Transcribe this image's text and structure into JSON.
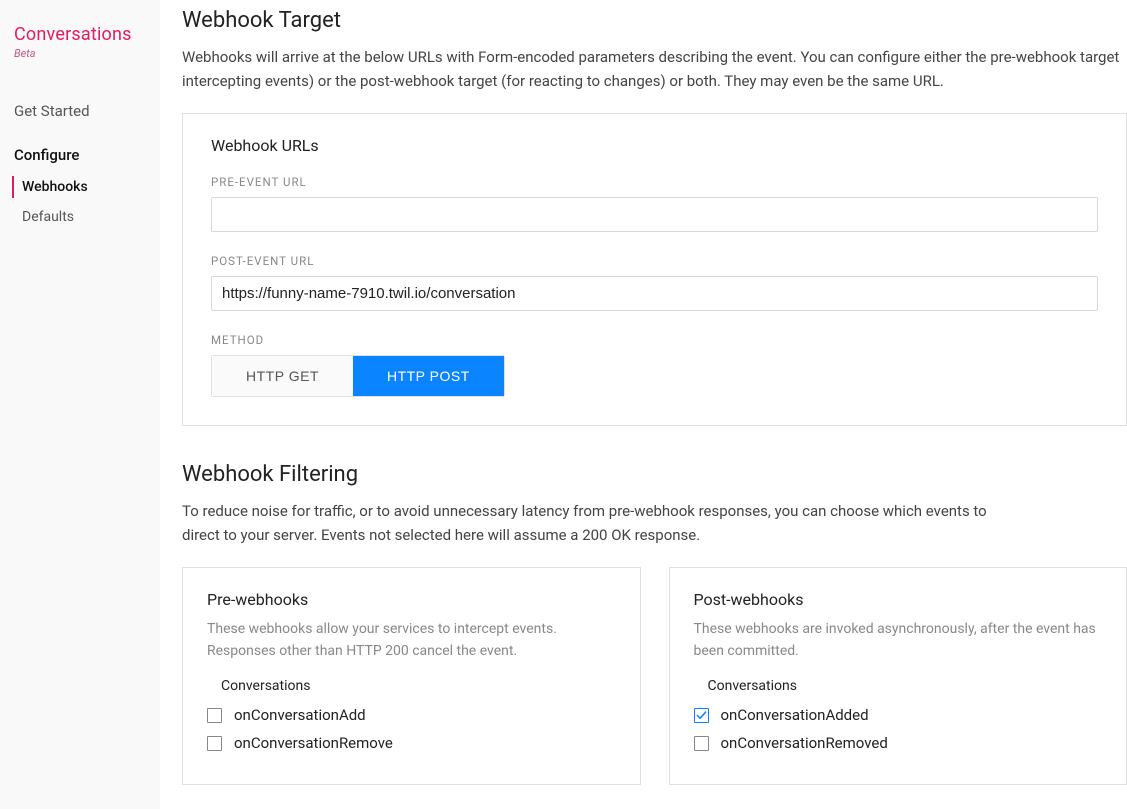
{
  "sidebar": {
    "brand": "Conversations",
    "beta": "Beta",
    "nav": {
      "get_started": "Get Started",
      "configure": "Configure",
      "webhooks": "Webhooks",
      "defaults": "Defaults"
    }
  },
  "target": {
    "heading": "Webhook Target",
    "description": "Webhooks will arrive at the below URLs with Form-encoded parameters describing the event. You can configure either the pre-webhook target intercepting events) or the post-webhook target (for reacting to changes) or both. They may even be the same URL.",
    "panel_title": "Webhook URLs",
    "pre_label": "PRE-EVENT URL",
    "pre_value": "",
    "post_label": "POST-EVENT URL",
    "post_value": "https://funny-name-7910.twil.io/conversation",
    "method_label": "METHOD",
    "http_get": "HTTP GET",
    "http_post": "HTTP POST"
  },
  "filtering": {
    "heading": "Webhook Filtering",
    "description": "To reduce noise for traffic, or to avoid unnecessary latency from pre-webhook responses, you can choose which events to direct to your server. Events not selected here will assume a 200 OK response.",
    "pre": {
      "title": "Pre-webhooks",
      "desc": "These webhooks allow your services to intercept events. Responses other than HTTP 200 cancel the event.",
      "group": "Conversations",
      "items": [
        {
          "label": "onConversationAdd",
          "checked": false
        },
        {
          "label": "onConversationRemove",
          "checked": false
        }
      ]
    },
    "post": {
      "title": "Post-webhooks",
      "desc": "These webhooks are invoked asynchronously, after the event has been committed.",
      "group": "Conversations",
      "items": [
        {
          "label": "onConversationAdded",
          "checked": true
        },
        {
          "label": "onConversationRemoved",
          "checked": false
        }
      ]
    }
  }
}
